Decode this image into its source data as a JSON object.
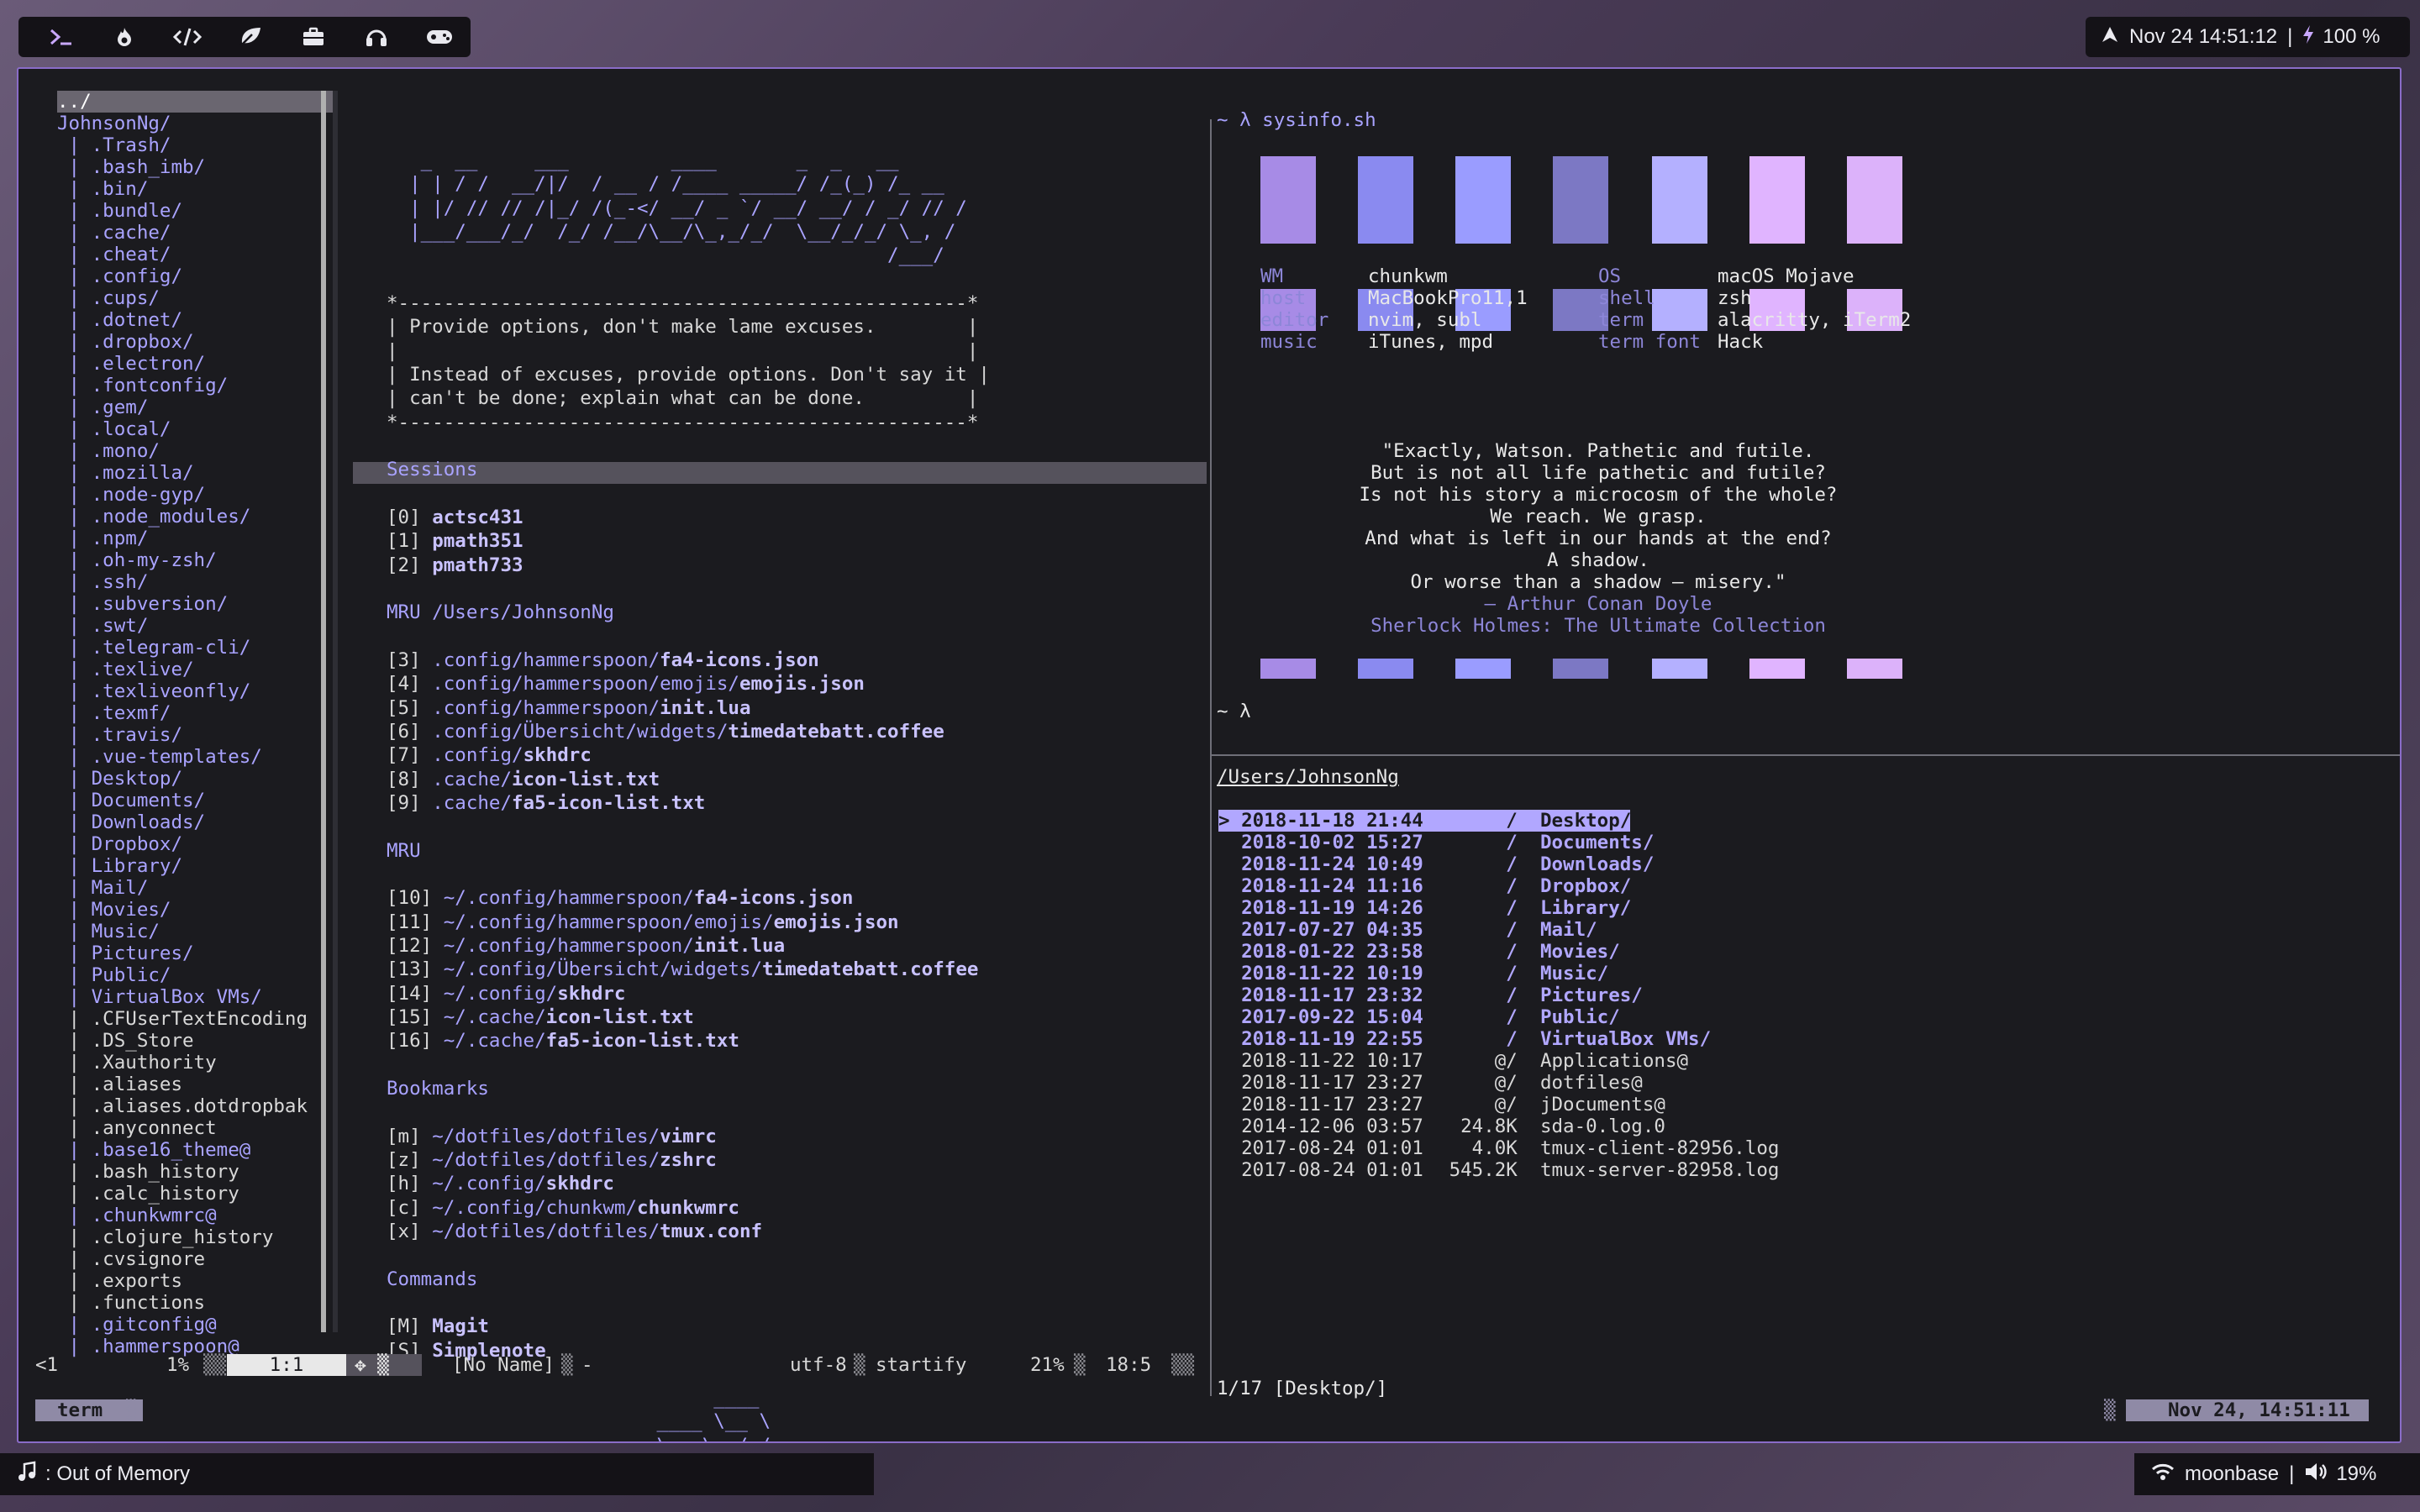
{
  "topbar": {
    "icons": [
      "terminal-icon",
      "fire-icon",
      "code-icon",
      "leaf-icon",
      "briefcase-icon",
      "headphones-icon",
      "gamepad-icon"
    ],
    "datetime": "Nov 24 14:51:12",
    "separator": "|",
    "battery": "100 %"
  },
  "tree": [
    {
      "t": "../",
      "k": "hl"
    },
    {
      "t": "JohnsonNg/",
      "k": "dir"
    },
    {
      "t": " | .Trash/",
      "k": "dir"
    },
    {
      "t": " | .bash_imb/",
      "k": "dir"
    },
    {
      "t": " | .bin/",
      "k": "dir"
    },
    {
      "t": " | .bundle/",
      "k": "dir"
    },
    {
      "t": " | .cache/",
      "k": "dir"
    },
    {
      "t": " | .cheat/",
      "k": "dir"
    },
    {
      "t": " | .config/",
      "k": "dir"
    },
    {
      "t": " | .cups/",
      "k": "dir"
    },
    {
      "t": " | .dotnet/",
      "k": "dir"
    },
    {
      "t": " | .dropbox/",
      "k": "dir"
    },
    {
      "t": " | .electron/",
      "k": "dir"
    },
    {
      "t": " | .fontconfig/",
      "k": "dir"
    },
    {
      "t": " | .gem/",
      "k": "dir"
    },
    {
      "t": " | .local/",
      "k": "dir"
    },
    {
      "t": " | .mono/",
      "k": "dir"
    },
    {
      "t": " | .mozilla/",
      "k": "dir"
    },
    {
      "t": " | .node-gyp/",
      "k": "dir"
    },
    {
      "t": " | .node_modules/",
      "k": "dir"
    },
    {
      "t": " | .npm/",
      "k": "dir"
    },
    {
      "t": " | .oh-my-zsh/",
      "k": "dir"
    },
    {
      "t": " | .ssh/",
      "k": "dir"
    },
    {
      "t": " | .subversion/",
      "k": "dir"
    },
    {
      "t": " | .swt/",
      "k": "dir"
    },
    {
      "t": " | .telegram-cli/",
      "k": "dir"
    },
    {
      "t": " | .texlive/",
      "k": "dir"
    },
    {
      "t": " | .texliveonfly/",
      "k": "dir"
    },
    {
      "t": " | .texmf/",
      "k": "dir"
    },
    {
      "t": " | .travis/",
      "k": "dir"
    },
    {
      "t": " | .vue-templates/",
      "k": "dir"
    },
    {
      "t": " | Desktop/",
      "k": "dir"
    },
    {
      "t": " | Documents/",
      "k": "dir"
    },
    {
      "t": " | Downloads/",
      "k": "dir"
    },
    {
      "t": " | Dropbox/",
      "k": "dir"
    },
    {
      "t": " | Library/",
      "k": "dir"
    },
    {
      "t": " | Mail/",
      "k": "dir"
    },
    {
      "t": " | Movies/",
      "k": "dir"
    },
    {
      "t": " | Music/",
      "k": "dir"
    },
    {
      "t": " | Pictures/",
      "k": "dir"
    },
    {
      "t": " | Public/",
      "k": "dir"
    },
    {
      "t": " | VirtualBox VMs/",
      "k": "dir"
    },
    {
      "t": " | .CFUserTextEncoding",
      "k": "file"
    },
    {
      "t": " | .DS_Store",
      "k": "file"
    },
    {
      "t": " | .Xauthority",
      "k": "file"
    },
    {
      "t": " | .aliases",
      "k": "file"
    },
    {
      "t": " | .aliases.dotdropbak",
      "k": "file"
    },
    {
      "t": " | .anyconnect",
      "k": "file"
    },
    {
      "t": " | .base16_theme@",
      "k": "dir"
    },
    {
      "t": " | .bash_history",
      "k": "file"
    },
    {
      "t": " | .calc_history",
      "k": "file"
    },
    {
      "t": " | .chunkwmrc@",
      "k": "dir"
    },
    {
      "t": " | .clojure_history",
      "k": "file"
    },
    {
      "t": " | .cvsignore",
      "k": "file"
    },
    {
      "t": " | .exports",
      "k": "file"
    },
    {
      "t": " | .functions",
      "k": "file"
    },
    {
      "t": " | .gitconfig@",
      "k": "dir"
    },
    {
      "t": " | .hammerspoon@",
      "k": "dir"
    }
  ],
  "startify": {
    "art": [
      "   _  __     ___         ____       _  _   __",
      "  | | / /  __/|/  / __ / /____ _____/ /_(_) /_ __",
      "  | |/ // // /|_/ /(_-</ __/ _ `/ __/ __/ / _/ // /",
      "  |___/___/_/  /_/ /__/\\__/\\_,_/_/  \\__/_/_/ \\_, /",
      "                                            /___/"
    ],
    "box": [
      "*--------------------------------------------------*",
      "| Provide options, don't make lame excuses.        |",
      "|                                                  |",
      "| Instead of excuses, provide options. Don't say it |",
      "| can't be done; explain what can be done.         |",
      "*--------------------------------------------------*"
    ],
    "sessions_head": "Sessions",
    "sessions": [
      {
        "n": "[0]",
        "f": "actsc431"
      },
      {
        "n": "[1]",
        "f": "pmath351"
      },
      {
        "n": "[2]",
        "f": "pmath733"
      }
    ],
    "mru_dir_head": "MRU /Users/JohnsonNg",
    "mru_dir": [
      {
        "n": "[3]",
        "p": ".config/hammerspoon/",
        "f": "fa4-icons.json"
      },
      {
        "n": "[4]",
        "p": ".config/hammerspoon/emojis/",
        "f": "emojis.json"
      },
      {
        "n": "[5]",
        "p": ".config/hammerspoon/",
        "f": "init.lua"
      },
      {
        "n": "[6]",
        "p": ".config/Übersicht/widgets/",
        "f": "timedatebatt.coffee"
      },
      {
        "n": "[7]",
        "p": ".config/",
        "f": "skhdrc"
      },
      {
        "n": "[8]",
        "p": ".cache/",
        "f": "icon-list.txt"
      },
      {
        "n": "[9]",
        "p": ".cache/",
        "f": "fa5-icon-list.txt"
      }
    ],
    "mru_head": "MRU",
    "mru": [
      {
        "n": "[10]",
        "p": "~/.config/hammerspoon/",
        "f": "fa4-icons.json"
      },
      {
        "n": "[11]",
        "p": "~/.config/hammerspoon/emojis/",
        "f": "emojis.json"
      },
      {
        "n": "[12]",
        "p": "~/.config/hammerspoon/",
        "f": "init.lua"
      },
      {
        "n": "[13]",
        "p": "~/.config/Übersicht/widgets/",
        "f": "timedatebatt.coffee"
      },
      {
        "n": "[14]",
        "p": "~/.config/",
        "f": "skhdrc"
      },
      {
        "n": "[15]",
        "p": "~/.cache/",
        "f": "icon-list.txt"
      },
      {
        "n": "[16]",
        "p": "~/.cache/",
        "f": "fa5-icon-list.txt"
      }
    ],
    "bookmarks_head": "Bookmarks",
    "bookmarks": [
      {
        "n": "[m]",
        "p": "~/dotfiles/dotfiles/",
        "f": "vimrc"
      },
      {
        "n": "[z]",
        "p": "~/dotfiles/dotfiles/",
        "f": "zshrc"
      },
      {
        "n": "[h]",
        "p": "~/.config/",
        "f": "skhdrc"
      },
      {
        "n": "[c]",
        "p": "~/.config/chunkwm/",
        "f": "chunkwmrc"
      },
      {
        "n": "[x]",
        "p": "~/dotfiles/dotfiles/",
        "f": "tmux.conf"
      }
    ],
    "commands_head": "Commands",
    "commands": [
      {
        "n": "[M]",
        "p": "",
        "f": "Magit"
      },
      {
        "n": "[S]",
        "p": "",
        "f": "Simplenote"
      }
    ],
    "footer_art": [
      "      ____",
      " ____ \\__ \\",
      " \\__ \\__/ / __",
      " __/ ____ \\ \\ \\    ___"
    ]
  },
  "sysinfo": {
    "prompt": "~ λ sysinfo.sh",
    "swatch_colors": [
      "#a78be6",
      "#8a8af0",
      "#9a9cff",
      "#7c78c4",
      "#b4b0ff",
      "#e0b4ff",
      "#dcb2fa"
    ],
    "rows": [
      {
        "l1": "WM",
        "v1": "chunkwm",
        "l2": "OS",
        "v2": "macOS Mojave"
      },
      {
        "l1": "host",
        "v1": "MacBookPro11,1",
        "l2": "shell",
        "v2": "zsh"
      },
      {
        "l1": "editor",
        "v1": "nvim, subl",
        "l2": "term",
        "v2": "alacritty, iTerm2"
      },
      {
        "l1": "music",
        "v1": "iTunes, mpd",
        "l2": "term font",
        "v2": "Hack"
      }
    ],
    "quote": [
      "\"Exactly, Watson. Pathetic and futile.",
      "But is not all life pathetic and futile?",
      "Is not his story a microcosm of the whole?",
      "We reach. We grasp.",
      "And what is left in our hands at the end?",
      "A shadow.",
      "Or worse than a shadow — misery.\""
    ],
    "author": "— Arthur Conan Doyle",
    "source": "Sherlock Holmes: The Ultimate Collection",
    "prompt2": "~ λ"
  },
  "ranger": {
    "path": "/Users/JohnsonNg",
    "rows": [
      {
        "d": "2018-11-18 21:44",
        "s": "/",
        "n": "Desktop/",
        "k": "sel"
      },
      {
        "d": "2018-10-02 15:27",
        "s": "/",
        "n": "Documents/",
        "k": "dir"
      },
      {
        "d": "2018-11-24 10:49",
        "s": "/",
        "n": "Downloads/",
        "k": "dir"
      },
      {
        "d": "2018-11-24 11:16",
        "s": "/",
        "n": "Dropbox/",
        "k": "dir"
      },
      {
        "d": "2018-11-19 14:26",
        "s": "/",
        "n": "Library/",
        "k": "dir"
      },
      {
        "d": "2017-07-27 04:35",
        "s": "/",
        "n": "Mail/",
        "k": "dir"
      },
      {
        "d": "2018-01-22 23:58",
        "s": "/",
        "n": "Movies/",
        "k": "dir"
      },
      {
        "d": "2018-11-22 10:19",
        "s": "/",
        "n": "Music/",
        "k": "dir"
      },
      {
        "d": "2018-11-17 23:32",
        "s": "/",
        "n": "Pictures/",
        "k": "dir"
      },
      {
        "d": "2017-09-22 15:04",
        "s": "/",
        "n": "Public/",
        "k": "dir"
      },
      {
        "d": "2018-11-19 22:55",
        "s": "/",
        "n": "VirtualBox VMs/",
        "k": "dir"
      },
      {
        "d": "2018-11-22 10:17",
        "s": "@/",
        "n": "Applications@",
        "k": "file"
      },
      {
        "d": "2018-11-17 23:27",
        "s": "@/",
        "n": "dotfiles@",
        "k": "file"
      },
      {
        "d": "2018-11-17 23:27",
        "s": "@/",
        "n": "jDocuments@",
        "k": "file"
      },
      {
        "d": "2014-12-06 03:57",
        "s": "24.8K",
        "n": "sda-0.log.0",
        "k": "file"
      },
      {
        "d": "2017-08-24 01:01",
        "s": "4.0K",
        "n": "tmux-client-82956.log",
        "k": "file"
      },
      {
        "d": "2017-08-24 01:01",
        "s": "545.2K",
        "n": "tmux-server-82958.log",
        "k": "file"
      }
    ],
    "status": "1/17 [Desktop/]"
  },
  "vim_status": {
    "left": "<1",
    "pct": "1%",
    "pos": "1:1",
    "name": "[No Name]",
    "dash": "-",
    "enc": "utf-8",
    "ft": "startify",
    "pct2": "21%",
    "pos2": "18:5"
  },
  "tmux": {
    "tab": "term",
    "date": "Nov 24, 14:51:11"
  },
  "bottom": {
    "now_playing": ": Out of Memory",
    "wifi": "moonbase",
    "separator": "|",
    "volume": "19%"
  }
}
